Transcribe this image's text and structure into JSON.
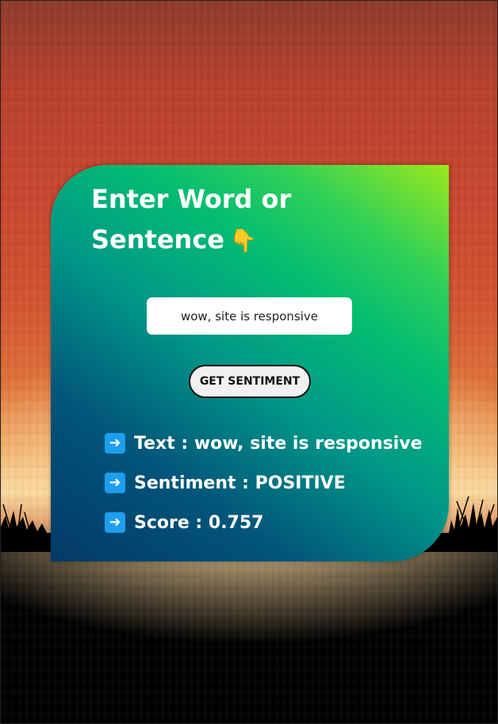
{
  "card": {
    "title_line1": "Enter Word or",
    "title_line2": "Sentence",
    "title_emoji": "👇"
  },
  "form": {
    "input_value": "wow, site is responsive",
    "button_label": "GET SENTIMENT"
  },
  "results": [
    {
      "label": "Text",
      "value": "wow, site is responsive",
      "text": "Text : wow, site is responsive"
    },
    {
      "label": "Sentiment",
      "value": "POSITIVE",
      "text": "Sentiment : POSITIVE"
    },
    {
      "label": "Score",
      "value": "0.757",
      "text": "Score : 0.757"
    }
  ],
  "icons": {
    "result_bullet": "right-arrow-icon",
    "title_hand": "pointing-down-hand-icon"
  },
  "colors": {
    "arrow_badge": "#1e9ef0",
    "card_top": "#9be81c",
    "card_bottom": "#033a66"
  }
}
